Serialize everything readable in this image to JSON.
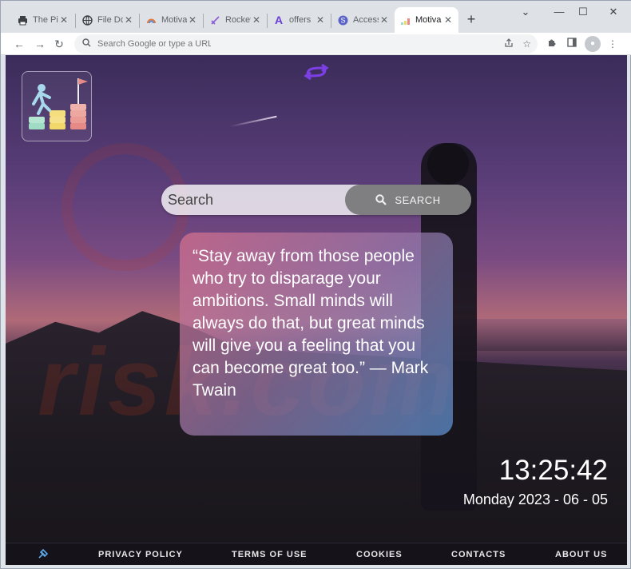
{
  "browser": {
    "tabs": [
      {
        "title": "The Pi",
        "icon": "print-icon"
      },
      {
        "title": "File Do",
        "icon": "globe-icon"
      },
      {
        "title": "Motiva",
        "icon": "rainbow-icon"
      },
      {
        "title": "Rocket",
        "icon": "rocket-icon"
      },
      {
        "title": "offers",
        "icon": "a-logo-icon"
      },
      {
        "title": "Access",
        "icon": "s-logo-icon"
      },
      {
        "title": "Motiva",
        "icon": "motivation-icon",
        "active": true
      }
    ],
    "address_placeholder": "Search Google or type a URL"
  },
  "page": {
    "search": {
      "placeholder": "Search",
      "button_label": "SEARCH"
    },
    "quote": "“Stay away from those people who try to disparage your ambitions. Small minds will always do that, but great minds will give you a feeling that you can become great too.” — Mark Twain",
    "time": "13:25:42",
    "date": "Monday 2023 - 06 - 05",
    "watermark": "risk.com",
    "footer": {
      "links": [
        "PRIVACY POLICY",
        "TERMS OF USE",
        "COOKIES",
        "CONTACTS",
        "ABOUT US"
      ]
    }
  },
  "colors": {
    "accent": "#7b3fe4",
    "footer_bg": "#16121a"
  }
}
